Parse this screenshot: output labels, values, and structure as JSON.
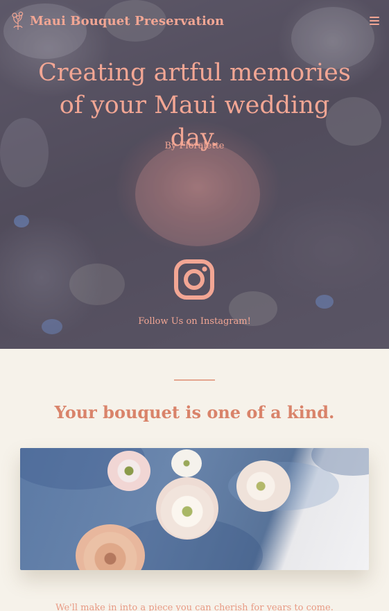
{
  "header": {
    "brand_name": "Maui Bouquet Preservation",
    "accent_color": "#f2a694"
  },
  "hero": {
    "title": "Creating artful memories of your Maui wedding day.",
    "byline": "By Floralette",
    "instagram_icon": "instagram-icon",
    "instagram_link": "Follow Us on Instagram!"
  },
  "intro": {
    "heading": "Your bouquet is one of a kind.",
    "image_alt": "ranunculus-and-roses-on-blue-cloth",
    "body": "We'll make in into a piece you can cherish for years to come."
  }
}
